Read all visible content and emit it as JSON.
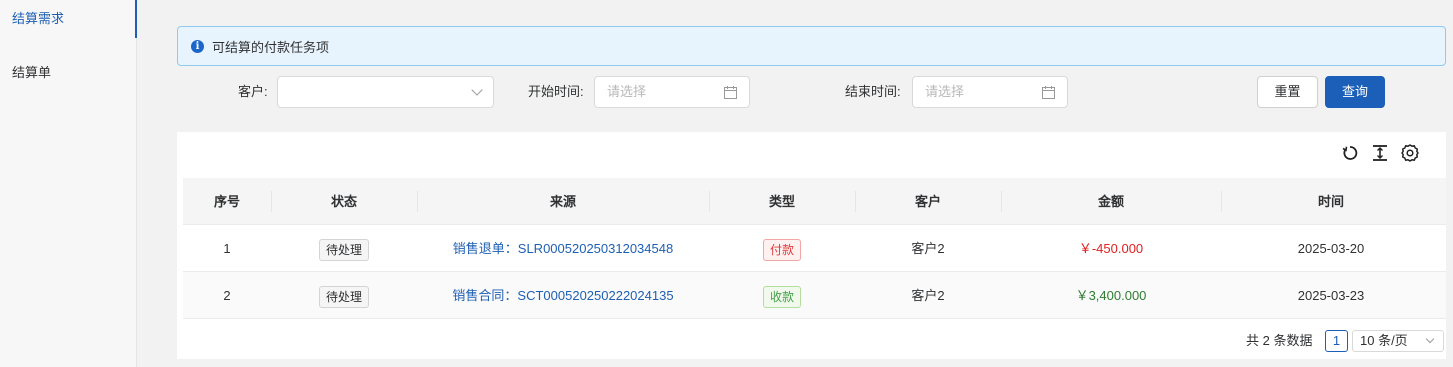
{
  "sidebar": {
    "items": [
      {
        "label": "结算需求"
      },
      {
        "label": "结算单"
      }
    ]
  },
  "alert": {
    "text": "可结算的付款任务项"
  },
  "filters": {
    "customer_label": "客户",
    "start_label": "开始时间",
    "end_label": "结束时间",
    "start_placeholder": "请选择",
    "end_placeholder": "请选择",
    "reset_label": "重置",
    "query_label": "查询"
  },
  "table": {
    "headers": [
      "序号",
      "状态",
      "来源",
      "类型",
      "客户",
      "金额",
      "时间"
    ],
    "rows": [
      {
        "index": "1",
        "status": "待处理",
        "source": "销售退单：SLR000520250312034548",
        "type": "付款",
        "customer": "客户2",
        "amount": "￥-450.000",
        "time": "2025-03-20"
      },
      {
        "index": "2",
        "status": "待处理",
        "source": "销售合同：SCT000520250222024135",
        "type": "收款",
        "customer": "客户2",
        "amount": "￥3,400.000",
        "time": "2025-03-23"
      }
    ]
  },
  "pagination": {
    "total_text": "共 2 条数据",
    "current_page": "1",
    "page_size": "10 条/页"
  },
  "colors": {
    "accent": "#1b5fb8",
    "negative": "#e02020",
    "positive": "#2e7d32"
  }
}
